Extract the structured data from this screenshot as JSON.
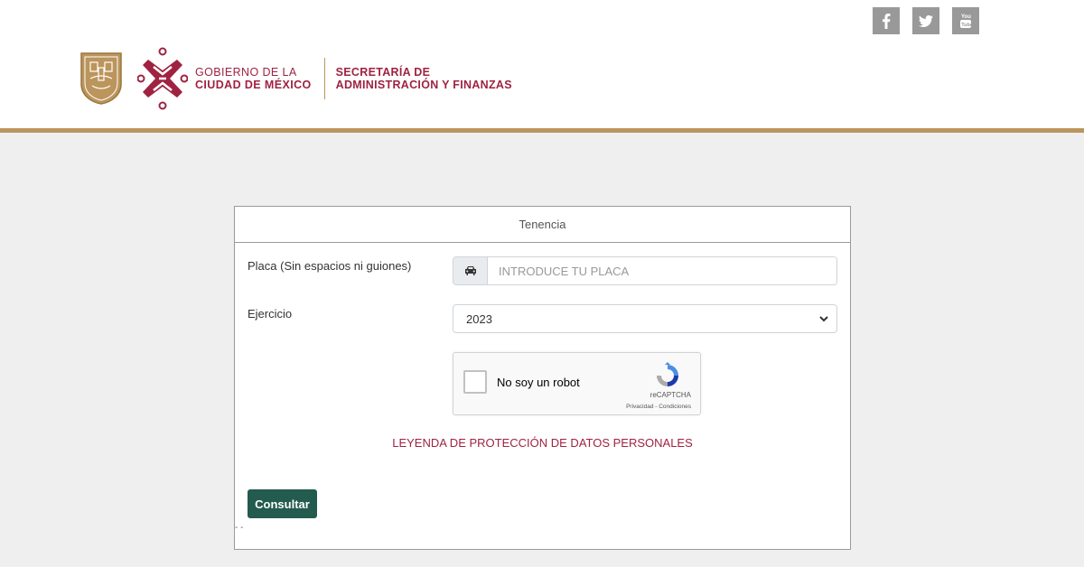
{
  "header": {
    "government_line1": "GOBIERNO DE LA",
    "government_line2": "CIUDAD DE MÉXICO",
    "secretariat_line1": "SECRETARÍA DE",
    "secretariat_line2": "ADMINISTRACIÓN Y FINANZAS",
    "social": [
      {
        "icon": "facebook-icon",
        "glyph": "f"
      },
      {
        "icon": "twitter-icon",
        "glyph": "t"
      },
      {
        "icon": "youtube-icon",
        "glyph": "You"
      }
    ]
  },
  "colors": {
    "brand_wine": "#9f2241",
    "brand_gold": "#bc955c",
    "button_green": "#235b4e"
  },
  "form": {
    "title": "Tenencia",
    "plate_label": "Placa (Sin espacios ni guiones)",
    "plate_placeholder": "INTRODUCE TU PLACA",
    "plate_value": "",
    "plate_icon": "car-icon",
    "year_label": "Ejercicio",
    "year_value": "2023",
    "captcha_label": "No soy un robot",
    "captcha_brand": "reCAPTCHA",
    "captcha_links": "Privacidad - Condiciones",
    "privacy_legend": "LEYENDA DE PROTECCIÓN DE DATOS PERSONALES",
    "submit_label": "Consultar",
    "footer_dashes": "- -"
  }
}
